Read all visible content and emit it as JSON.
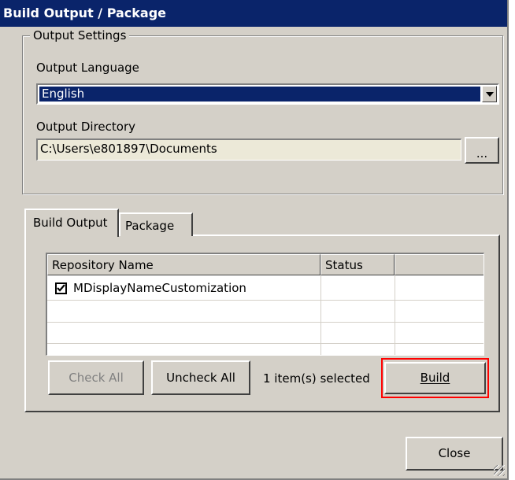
{
  "window": {
    "title": "Build Output / Package"
  },
  "output_settings": {
    "group_label": "Output Settings",
    "language_label": "Output Language",
    "language_value": "English",
    "directory_label": "Output Directory",
    "directory_value": "C:\\Users\\e801897\\Documents",
    "browse_label": "..."
  },
  "tabs": [
    {
      "label": "Build Output",
      "active": true
    },
    {
      "label": "Package",
      "active": false
    }
  ],
  "list": {
    "columns": [
      "Repository Name",
      "Status",
      ""
    ],
    "rows": [
      {
        "name": "MDisplayNameCustomization",
        "status": "",
        "checked": true
      }
    ]
  },
  "buttons": {
    "check_all": "Check All",
    "uncheck_all": "Uncheck All",
    "build": "Build",
    "close": "Close"
  },
  "status": {
    "selected_text": "1 item(s) selected"
  },
  "colors": {
    "titlebar": "#0a246a",
    "face": "#d4d0c8",
    "highlight_box": "#ff0000"
  }
}
